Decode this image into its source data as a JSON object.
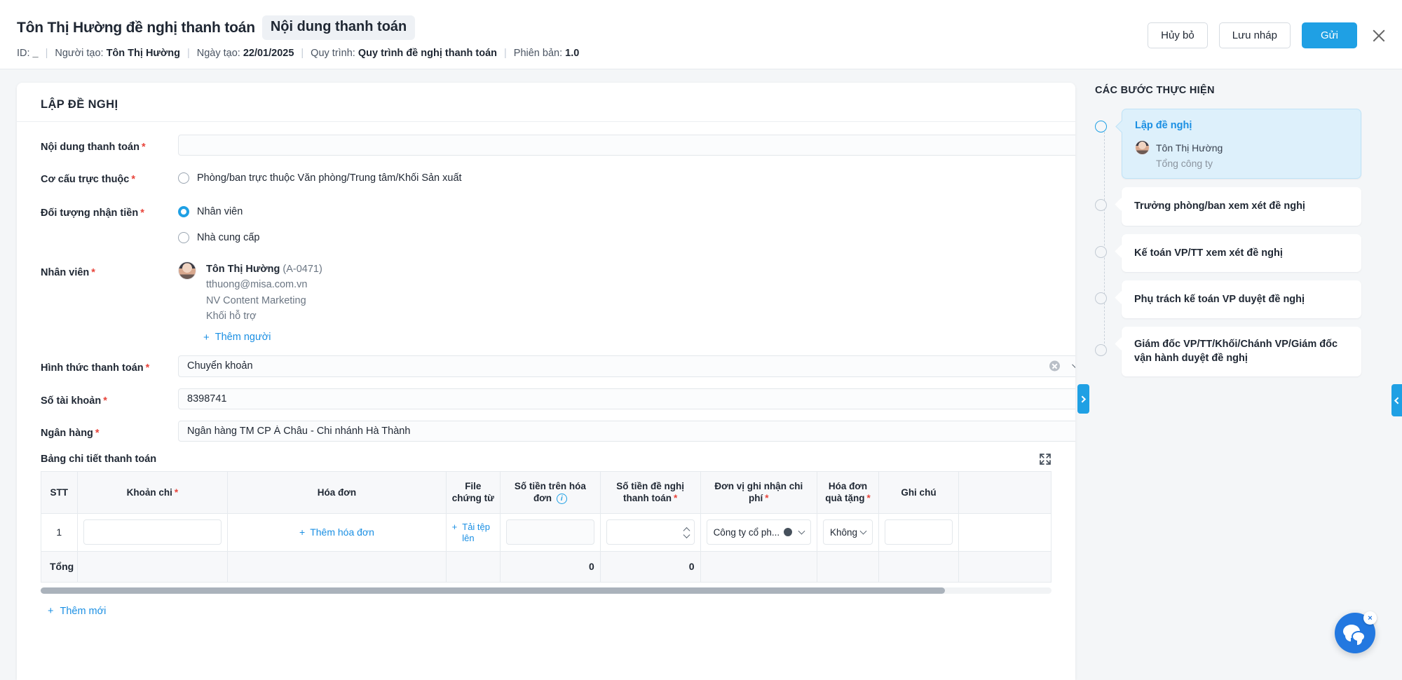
{
  "header": {
    "title": "Tôn Thị Hường đề nghị thanh toán",
    "chip": "Nội dung thanh toán",
    "meta": {
      "id_label": "ID:",
      "id_value": "_",
      "creator_label": "Người tạo:",
      "creator_value": "Tôn Thị Hường",
      "created_label": "Ngày tạo:",
      "created_value": "22/01/2025",
      "process_label": "Quy trình:",
      "process_value": "Quy trình đề nghị thanh toán",
      "version_label": "Phiên bản:",
      "version_value": "1.0"
    },
    "buttons": {
      "cancel": "Hủy bỏ",
      "save_draft": "Lưu nháp",
      "submit": "Gửi"
    }
  },
  "form": {
    "section_title": "LẬP ĐỀ NGHỊ",
    "fields": {
      "content_label": "Nội dung thanh toán",
      "content_value": "",
      "structure_label": "Cơ cấu trực thuộc",
      "structure_option": "Phòng/ban trực thuộc Văn phòng/Trung tâm/Khối Sản xuất",
      "recipient_label": "Đối tượng nhận tiền",
      "recipient_option_1": "Nhân viên",
      "recipient_option_2": "Nhà cung cấp",
      "recipient_selected": "Nhân viên",
      "employee_label": "Nhân viên",
      "employee_name": "Tôn Thị Hường",
      "employee_code": "(A-0471)",
      "employee_email": "tthuong@misa.com.vn",
      "employee_position": "NV Content Marketing",
      "employee_unit": "Khối hỗ trợ",
      "add_person": "Thêm người",
      "payment_method_label": "Hình thức thanh toán",
      "payment_method_value": "Chuyển khoản",
      "account_label": "Số tài khoản",
      "account_value": "8398741",
      "bank_label": "Ngân hàng",
      "bank_value": "Ngân hàng TM CP Á Châu - Chi nhánh Hà Thành"
    }
  },
  "table": {
    "title": "Bảng chi tiết thanh toán",
    "columns": [
      {
        "label": "STT",
        "required": false,
        "info": false
      },
      {
        "label": "Khoản chi",
        "required": true,
        "info": false
      },
      {
        "label": "Hóa đơn",
        "required": false,
        "info": false
      },
      {
        "label": "File chứng từ",
        "required": false,
        "info": false
      },
      {
        "label": "Số tiền trên hóa đơn",
        "required": false,
        "info": true
      },
      {
        "label": "Số tiền đề nghị thanh toán",
        "required": true,
        "info": false
      },
      {
        "label": "Đơn vị ghi nhận chi phí",
        "required": true,
        "info": false
      },
      {
        "label": "Hóa đơn quà tặng",
        "required": true,
        "info": false
      },
      {
        "label": "Ghi chú",
        "required": false,
        "info": false
      }
    ],
    "rows": [
      {
        "stt": "1",
        "khoan_chi": "",
        "hoa_don_link": "Thêm hóa đơn",
        "file_link": "Tải tệp lên",
        "so_tien_hoa_don": "",
        "so_tien_de_nghi": "",
        "don_vi": "Công ty cổ ph...",
        "hoa_don_qua_tang": "Không",
        "ghi_chu": ""
      }
    ],
    "total_label": "Tổng",
    "total_invoice_amount": "0",
    "total_requested_amount": "0",
    "add_new": "Thêm mới"
  },
  "rail": {
    "title": "CÁC BƯỚC THỰC HIỆN",
    "steps": [
      {
        "title": "Lập đề nghị",
        "person": "Tôn Thị Hường",
        "org": "Tổng công ty",
        "active": true
      },
      {
        "title": "Trưởng phòng/ban xem xét đề nghị",
        "person": "",
        "org": "",
        "active": false
      },
      {
        "title": "Kế toán VP/TT xem xét đề nghị",
        "person": "",
        "org": "",
        "active": false
      },
      {
        "title": "Phụ trách kế toán VP duyệt đề nghị",
        "person": "",
        "org": "",
        "active": false
      },
      {
        "title": "Giám đốc VP/TT/Khối/Chánh VP/Giám đốc vận hành duyệt đề nghị",
        "person": "",
        "org": "",
        "active": false
      }
    ]
  },
  "colors": {
    "accent": "#1fa0e4",
    "required": "#e8453c",
    "chat": "#2378e0",
    "step_active_bg": "#ddf0fb"
  }
}
